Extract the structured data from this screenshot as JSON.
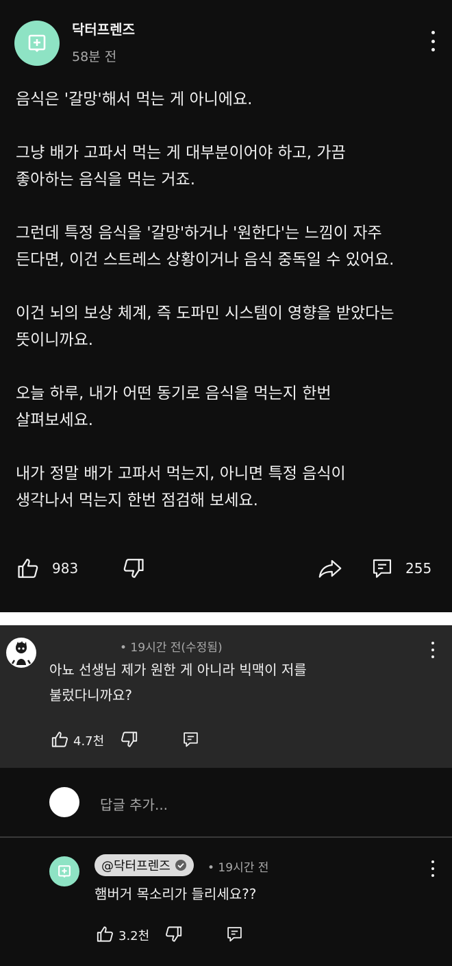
{
  "post": {
    "channel_name": "닥터프렌즈",
    "time": "58분 전",
    "paragraphs": [
      "음식은 '갈망'해서 먹는 게 아니에요.",
      "그냥 배가 고파서 먹는 게 대부분이어야 하고, 가끔\n좋아하는 음식을 먹는 거죠.",
      "그런데 특정 음식을 '갈망'하거나 '원한다'는 느낌이 자주\n든다면, 이건 스트레스 상황이거나 음식 중독일 수 있어요.",
      "이건 뇌의 보상 체계, 즉 도파민 시스템이 영향을 받았다는\n뜻이니까요.",
      "오늘 하루, 내가 어떤 동기로 음식을 먹는지 한번\n살펴보세요.",
      "내가 정말 배가 고파서 먹는지, 아니면 특정 음식이\n생각나서 먹는지 한번 점검해 보세요."
    ],
    "like_count": "983",
    "comment_count": "255",
    "icons": {
      "avatar": "channel-logo-icon",
      "more": "more-vert-icon",
      "like": "thumb-up-icon",
      "dislike": "thumb-down-icon",
      "share": "share-icon",
      "comments": "comment-icon"
    }
  },
  "comment": {
    "meta": "• 19시간 전(수정됨)",
    "text": "아뇨 선생님 제가 원한 게 아니라 빅맥이 저를\n불렀다니까요?",
    "like_count": "4.7천"
  },
  "add_reply": {
    "placeholder": "답글 추가..."
  },
  "reply": {
    "author": "@닥터프렌즈",
    "meta": "• 19시간 전",
    "text": "햄버거 목소리가 들리세요??",
    "like_count": "3.2천"
  },
  "colors": {
    "background": "#0f0f0f",
    "comment_bg": "#282828",
    "channel_avatar": "#8ee3c4",
    "text": "#f1f1f1",
    "muted": "#aaaaaa"
  }
}
